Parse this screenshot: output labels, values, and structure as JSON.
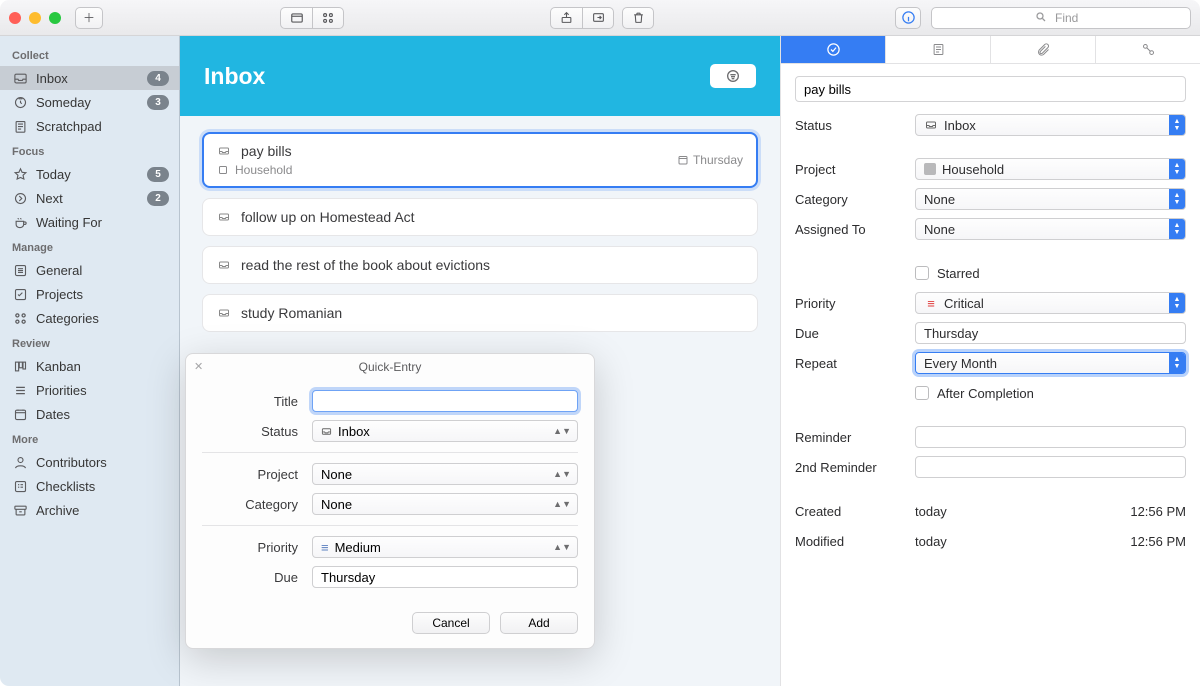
{
  "toolbar": {
    "search_placeholder": "Find"
  },
  "sidebar": {
    "sections": [
      {
        "label": "Collect",
        "items": [
          {
            "id": "inbox",
            "label": "Inbox",
            "count": "4",
            "icon": "inbox"
          },
          {
            "id": "someday",
            "label": "Someday",
            "count": "3",
            "icon": "someday"
          },
          {
            "id": "scratchpad",
            "label": "Scratchpad",
            "icon": "scratch"
          }
        ]
      },
      {
        "label": "Focus",
        "items": [
          {
            "id": "today",
            "label": "Today",
            "count": "5",
            "icon": "star"
          },
          {
            "id": "next",
            "label": "Next",
            "count": "2",
            "icon": "arrow-circle"
          },
          {
            "id": "waiting",
            "label": "Waiting For",
            "icon": "cup"
          }
        ]
      },
      {
        "label": "Manage",
        "items": [
          {
            "id": "general",
            "label": "General",
            "icon": "list"
          },
          {
            "id": "projects",
            "label": "Projects",
            "icon": "check-list"
          },
          {
            "id": "categories",
            "label": "Categories",
            "icon": "grid"
          }
        ]
      },
      {
        "label": "Review",
        "items": [
          {
            "id": "kanban",
            "label": "Kanban",
            "icon": "kanban"
          },
          {
            "id": "priorities",
            "label": "Priorities",
            "icon": "priorities"
          },
          {
            "id": "dates",
            "label": "Dates",
            "icon": "calendar"
          }
        ]
      },
      {
        "label": "More",
        "items": [
          {
            "id": "contributors",
            "label": "Contributors",
            "icon": "person"
          },
          {
            "id": "checklists",
            "label": "Checklists",
            "icon": "check-list"
          },
          {
            "id": "archive",
            "label": "Archive",
            "icon": "archive"
          }
        ]
      }
    ]
  },
  "main": {
    "title": "Inbox",
    "tasks": [
      {
        "id": "t1",
        "title": "pay bills",
        "project": "Household",
        "due": "Thursday",
        "selected": true
      },
      {
        "id": "t2",
        "title": "follow up on Homestead Act"
      },
      {
        "id": "t3",
        "title": "read the rest of the book about evictions"
      },
      {
        "id": "t4",
        "title": "study Romanian"
      }
    ]
  },
  "inspector": {
    "title": "pay bills",
    "labels": {
      "status": "Status",
      "project": "Project",
      "category": "Category",
      "assigned": "Assigned To",
      "starred": "Starred",
      "priority": "Priority",
      "due": "Due",
      "repeat": "Repeat",
      "after_completion": "After Completion",
      "reminder": "Reminder",
      "reminder2": "2nd Reminder",
      "created": "Created",
      "modified": "Modified"
    },
    "values": {
      "status": "Inbox",
      "project": "Household",
      "category": "None",
      "assigned": "None",
      "priority": "Critical",
      "due": "Thursday",
      "repeat": "Every Month",
      "reminder": "",
      "reminder2": "",
      "created_date": "today",
      "created_time": "12:56 PM",
      "modified_date": "today",
      "modified_time": "12:56 PM"
    }
  },
  "quick_entry": {
    "window_title": "Quick-Entry",
    "labels": {
      "title": "Title",
      "status": "Status",
      "project": "Project",
      "category": "Category",
      "priority": "Priority",
      "due": "Due"
    },
    "values": {
      "title": "",
      "status": "Inbox",
      "project": "None",
      "category": "None",
      "priority": "Medium",
      "due": "Thursday"
    },
    "buttons": {
      "cancel": "Cancel",
      "add": "Add"
    }
  }
}
